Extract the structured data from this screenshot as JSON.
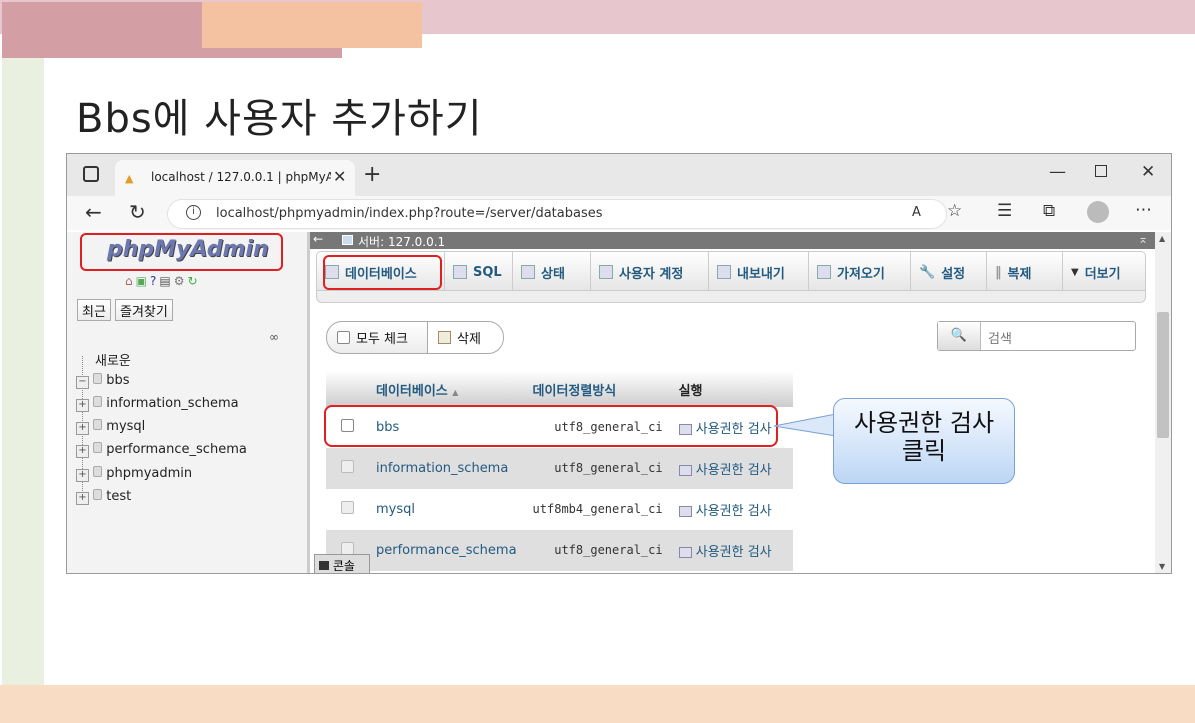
{
  "slide": {
    "title": "Bbs에 사용자 추가하기"
  },
  "browser": {
    "tab_title": "localhost / 127.0.0.1 | phpMyAdm",
    "url": "localhost/phpmyadmin/index.php?route=/server/databases"
  },
  "pma": {
    "logo": "phpMyAdmin",
    "nav_buttons": [
      "최근",
      "즐겨찾기"
    ],
    "tree": [
      "새로운",
      "bbs",
      "information_schema",
      "mysql",
      "performance_schema",
      "phpmyadmin",
      "test"
    ],
    "server_label": "서버: 127.0.0.1",
    "menu_tabs": [
      "데이터베이스",
      "SQL",
      "상태",
      "사용자 계정",
      "내보내기",
      "가져오기",
      "설정",
      "복제",
      "더보기"
    ],
    "check_all": "모두 체크",
    "delete": "삭제",
    "search_placeholder": "검색",
    "table": {
      "headers": [
        "데이터베이스",
        "데이터정렬방식",
        "실행"
      ],
      "rows": [
        {
          "name": "bbs",
          "collation": "utf8_general_ci",
          "action": "사용권한 검사"
        },
        {
          "name": "information_schema",
          "collation": "utf8_general_ci",
          "action": "사용권한 검사"
        },
        {
          "name": "mysql",
          "collation": "utf8mb4_general_ci",
          "action": "사용권한 검사"
        },
        {
          "name": "performance_schema",
          "collation": "utf8_general_ci",
          "action": "사용권한 검사"
        }
      ]
    },
    "console": "콘솔"
  },
  "callout": {
    "line1": "사용권한 검사",
    "line2": "클릭"
  },
  "colors": {
    "accent_red": "#e02020",
    "pma_blue": "#235a81",
    "header_bar": "#e8c6cd",
    "footer_bar": "#f9dcc4"
  }
}
